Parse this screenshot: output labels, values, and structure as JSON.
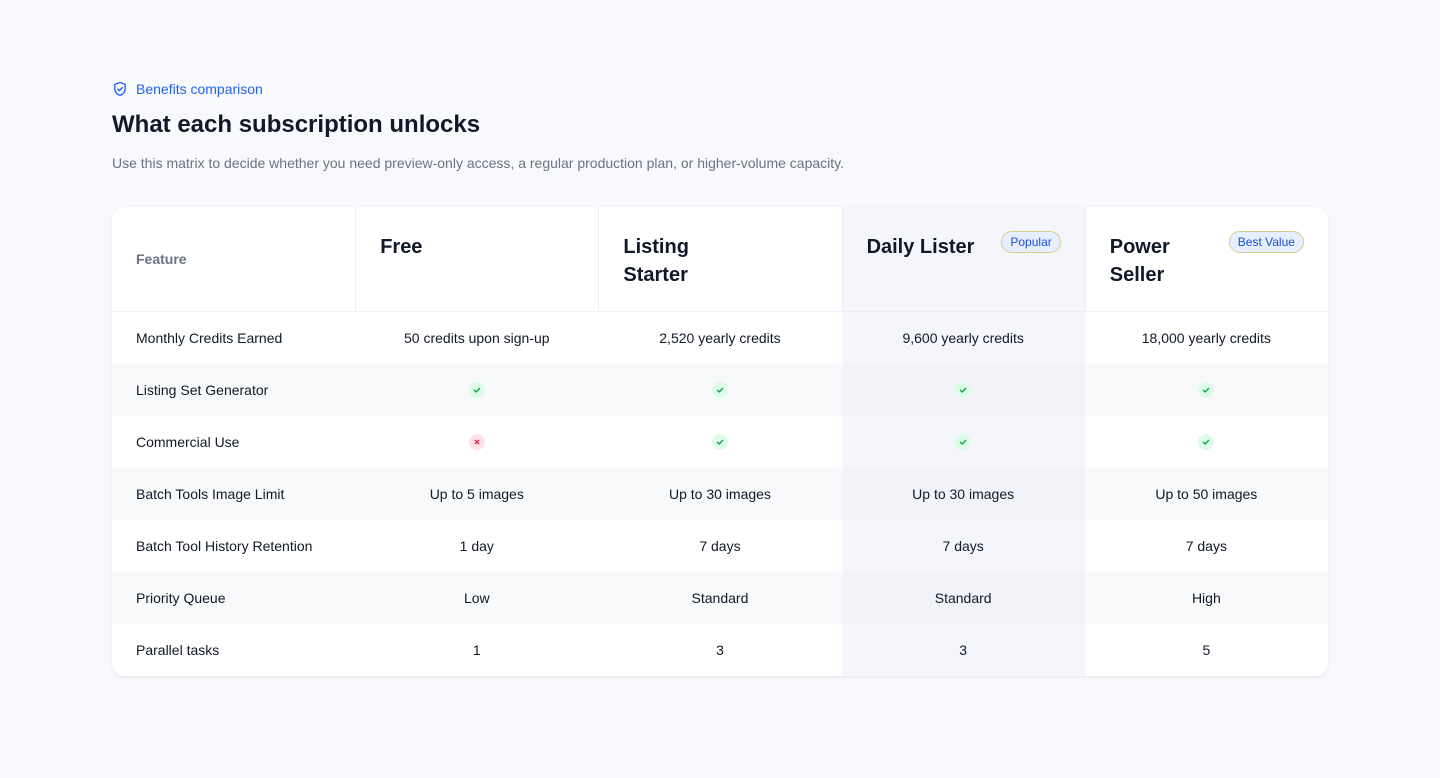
{
  "header": {
    "eyebrow": "Benefits comparison",
    "title": "What each subscription unlocks",
    "subtitle": "Use this matrix to decide whether you need preview-only access, a regular production plan, or higher-volume capacity."
  },
  "table": {
    "feature_header": "Feature",
    "plans": [
      {
        "name": "Free",
        "badge": ""
      },
      {
        "name": "Listing Starter",
        "badge": ""
      },
      {
        "name": "Daily Lister",
        "badge": "Popular"
      },
      {
        "name": "Power Seller",
        "badge": "Best Value"
      }
    ],
    "rows": [
      {
        "feature": "Monthly Credits Earned",
        "values": [
          "50 credits upon sign-up",
          "2,520 yearly credits",
          "9,600 yearly credits",
          "18,000 yearly credits"
        ]
      },
      {
        "feature": "Listing Set Generator",
        "values": [
          "check-icon",
          "check-icon",
          "check-icon",
          "check-icon"
        ]
      },
      {
        "feature": "Commercial Use",
        "values": [
          "cross-icon",
          "check-icon",
          "check-icon",
          "check-icon"
        ]
      },
      {
        "feature": "Batch Tools Image Limit",
        "values": [
          "Up to 5 images",
          "Up to 30 images",
          "Up to 30 images",
          "Up to 50 images"
        ]
      },
      {
        "feature": "Batch Tool History Retention",
        "values": [
          "1 day",
          "7 days",
          "7 days",
          "7 days"
        ]
      },
      {
        "feature": "Priority Queue",
        "values": [
          "Low",
          "Standard",
          "Standard",
          "High"
        ]
      },
      {
        "feature": "Parallel tasks",
        "values": [
          "1",
          "3",
          "3",
          "5"
        ]
      }
    ]
  },
  "colors": {
    "accent": "#2563eb",
    "check": "#16a34a",
    "cross": "#e11d48",
    "highlight_column": "#f4f6fb"
  }
}
